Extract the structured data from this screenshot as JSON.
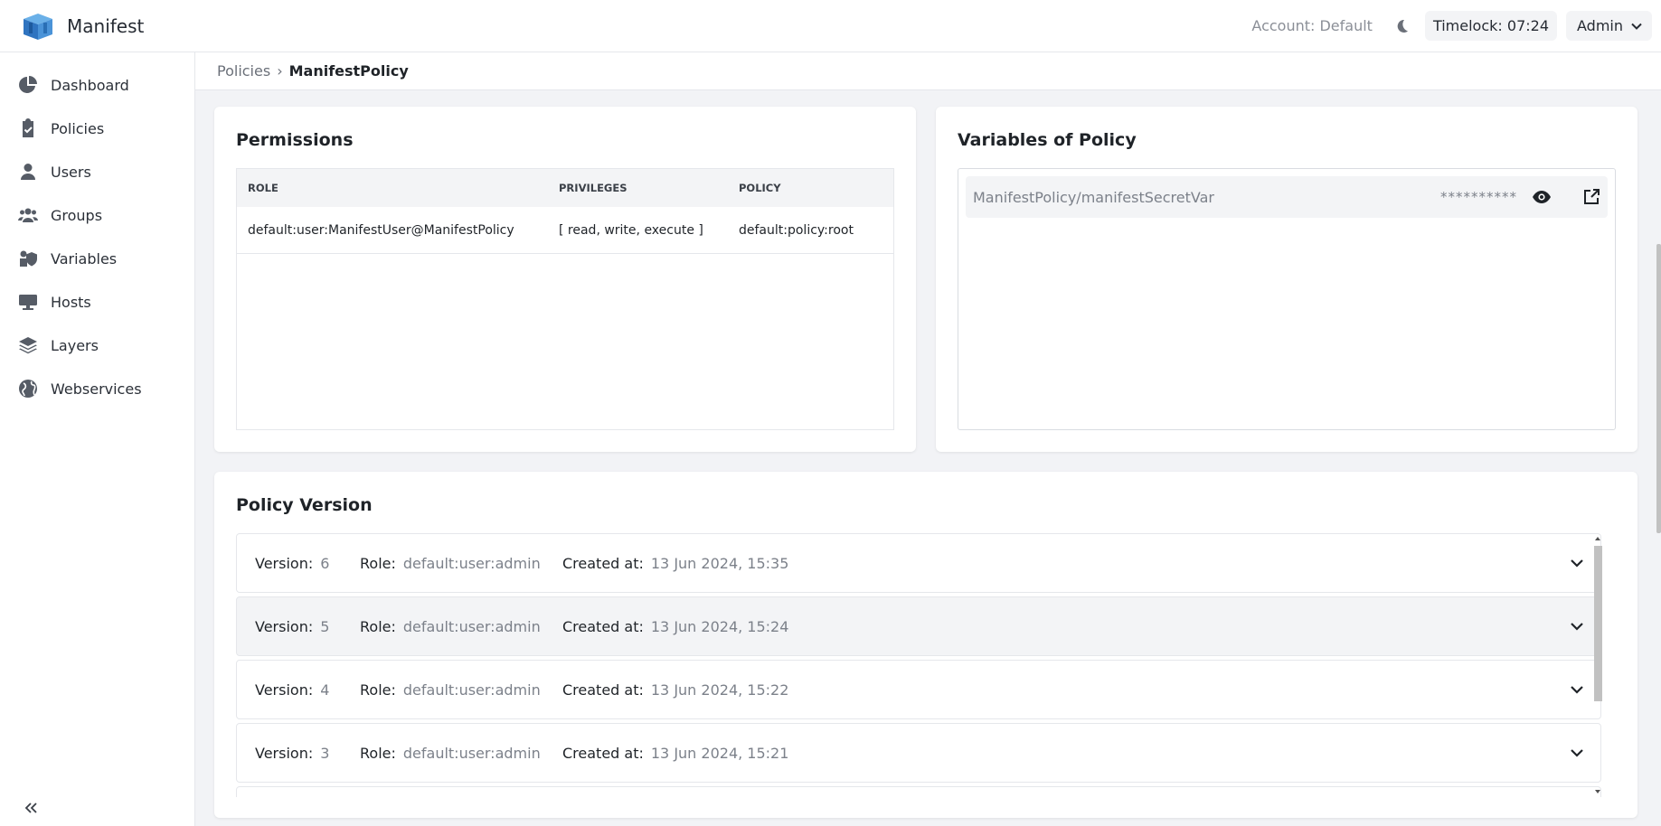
{
  "app": {
    "name": "Manifest",
    "account": "Account: Default",
    "timelock": "Timelock: 07:24",
    "user": "Admin"
  },
  "sidebar": {
    "items": [
      {
        "label": "Dashboard",
        "icon": "dashboard-icon"
      },
      {
        "label": "Policies",
        "icon": "policies-icon"
      },
      {
        "label": "Users",
        "icon": "user-icon"
      },
      {
        "label": "Groups",
        "icon": "groups-icon"
      },
      {
        "label": "Variables",
        "icon": "variables-icon"
      },
      {
        "label": "Hosts",
        "icon": "hosts-icon"
      },
      {
        "label": "Layers",
        "icon": "layers-icon"
      },
      {
        "label": "Webservices",
        "icon": "globe-icon"
      }
    ],
    "collapse_icon": "double-chevron-left-icon"
  },
  "breadcrumb": {
    "parent": "Policies",
    "separator": "›",
    "current": "ManifestPolicy"
  },
  "permissions": {
    "title": "Permissions",
    "columns": [
      "ROLE",
      "PRIVILEGES",
      "POLICY"
    ],
    "rows": [
      {
        "role": "default:user:ManifestUser@ManifestPolicy",
        "privileges": "[ read, write, execute ]",
        "policy": "default:policy:root"
      }
    ]
  },
  "variables": {
    "title": "Variables of Policy",
    "items": [
      {
        "name": "ManifestPolicy/manifestSecretVar",
        "mask": "**********"
      }
    ]
  },
  "versions": {
    "title": "Policy Version",
    "labels": {
      "version": "Version:",
      "role": "Role:",
      "created": "Created at:"
    },
    "items": [
      {
        "version": "6",
        "role": "default:user:admin",
        "created": "13 Jun 2024, 15:35"
      },
      {
        "version": "5",
        "role": "default:user:admin",
        "created": "13 Jun 2024, 15:24"
      },
      {
        "version": "4",
        "role": "default:user:admin",
        "created": "13 Jun 2024, 15:22"
      },
      {
        "version": "3",
        "role": "default:user:admin",
        "created": "13 Jun 2024, 15:21"
      }
    ]
  },
  "colors": {
    "accent": "#3b82c4",
    "icon": "#565c66",
    "muted": "#7c818a"
  }
}
